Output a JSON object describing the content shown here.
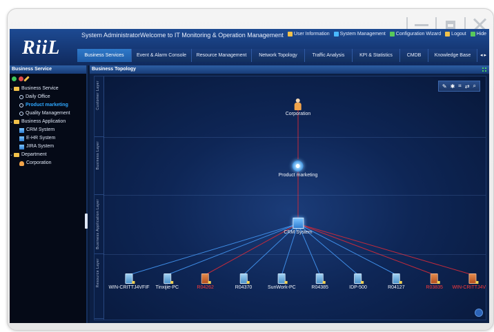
{
  "window_controls": [
    "minimize",
    "maximize",
    "close"
  ],
  "header": {
    "logo": "RiiL",
    "title": "System AdministratorWelcome to IT Monitoring & Operation Management",
    "user_actions": [
      {
        "label": "User Information",
        "icon": "user-info-icon",
        "color": "#f2c14a"
      },
      {
        "label": "System Management",
        "icon": "gear-icon",
        "color": "#49b8ff"
      },
      {
        "label": "Configuration Wizard",
        "icon": "wizard-icon",
        "color": "#58c95b"
      },
      {
        "label": "Logout",
        "icon": "logout-icon",
        "color": "#f2c14a"
      },
      {
        "label": "Hide",
        "icon": "hide-icon",
        "color": "#58c95b"
      }
    ]
  },
  "tabs": [
    {
      "label": "Business Services",
      "active": true
    },
    {
      "label": "Event & Alarm Console"
    },
    {
      "label": "Resource Management"
    },
    {
      "label": "Network Topology"
    },
    {
      "label": "Traffic Analysis"
    },
    {
      "label": "KPI & Statistics"
    },
    {
      "label": "CMDB"
    },
    {
      "label": "Knowledge Base"
    }
  ],
  "tabs_more": "◂ ▸",
  "sidebar": {
    "title": "Business Service",
    "groups": [
      {
        "label": "Business Service",
        "items": [
          {
            "label": "Daily Office",
            "icon": "magnifier-icon"
          },
          {
            "label": "Product marketing",
            "icon": "magnifier-icon",
            "selected": true
          },
          {
            "label": "Quality Management",
            "icon": "magnifier-icon"
          }
        ]
      },
      {
        "label": "Business Application",
        "items": [
          {
            "label": "CRM System",
            "icon": "app-icon"
          },
          {
            "label": "E-HR System",
            "icon": "app-icon"
          },
          {
            "label": "JIRA System",
            "icon": "app-icon"
          }
        ]
      },
      {
        "label": "Department",
        "items": [
          {
            "label": "Corporation",
            "icon": "person-icon"
          }
        ]
      }
    ]
  },
  "main": {
    "title": "Business Topology",
    "layers": [
      "Customer Layer",
      "Business Layer",
      "Business Application Layer",
      "Resource Layer"
    ],
    "toolbar": [
      "✎",
      "✱",
      "⌗",
      "⇄",
      "⌕"
    ],
    "nodes": {
      "corporation": "Corporation",
      "product": "Product marketing",
      "crm": "CRM System"
    },
    "resources": [
      {
        "label": "WIN-CRITTJ4VFIF",
        "alert": false
      },
      {
        "label": "Tinxijie-PC",
        "alert": false
      },
      {
        "label": "R04262",
        "alert": true
      },
      {
        "label": "R04370",
        "alert": false
      },
      {
        "label": "SunWork-PC",
        "alert": false
      },
      {
        "label": "R04385",
        "alert": false
      },
      {
        "label": "IDP-500",
        "alert": false
      },
      {
        "label": "R04127",
        "alert": false
      },
      {
        "label": "R03835",
        "alert": true
      },
      {
        "label": "WIN-CRITTJ4VFIF",
        "alert": true
      }
    ],
    "colors": {
      "link_normal": "#3f8de6",
      "link_alert": "#c52a3b",
      "alert_text": "#ff3a3a"
    }
  }
}
